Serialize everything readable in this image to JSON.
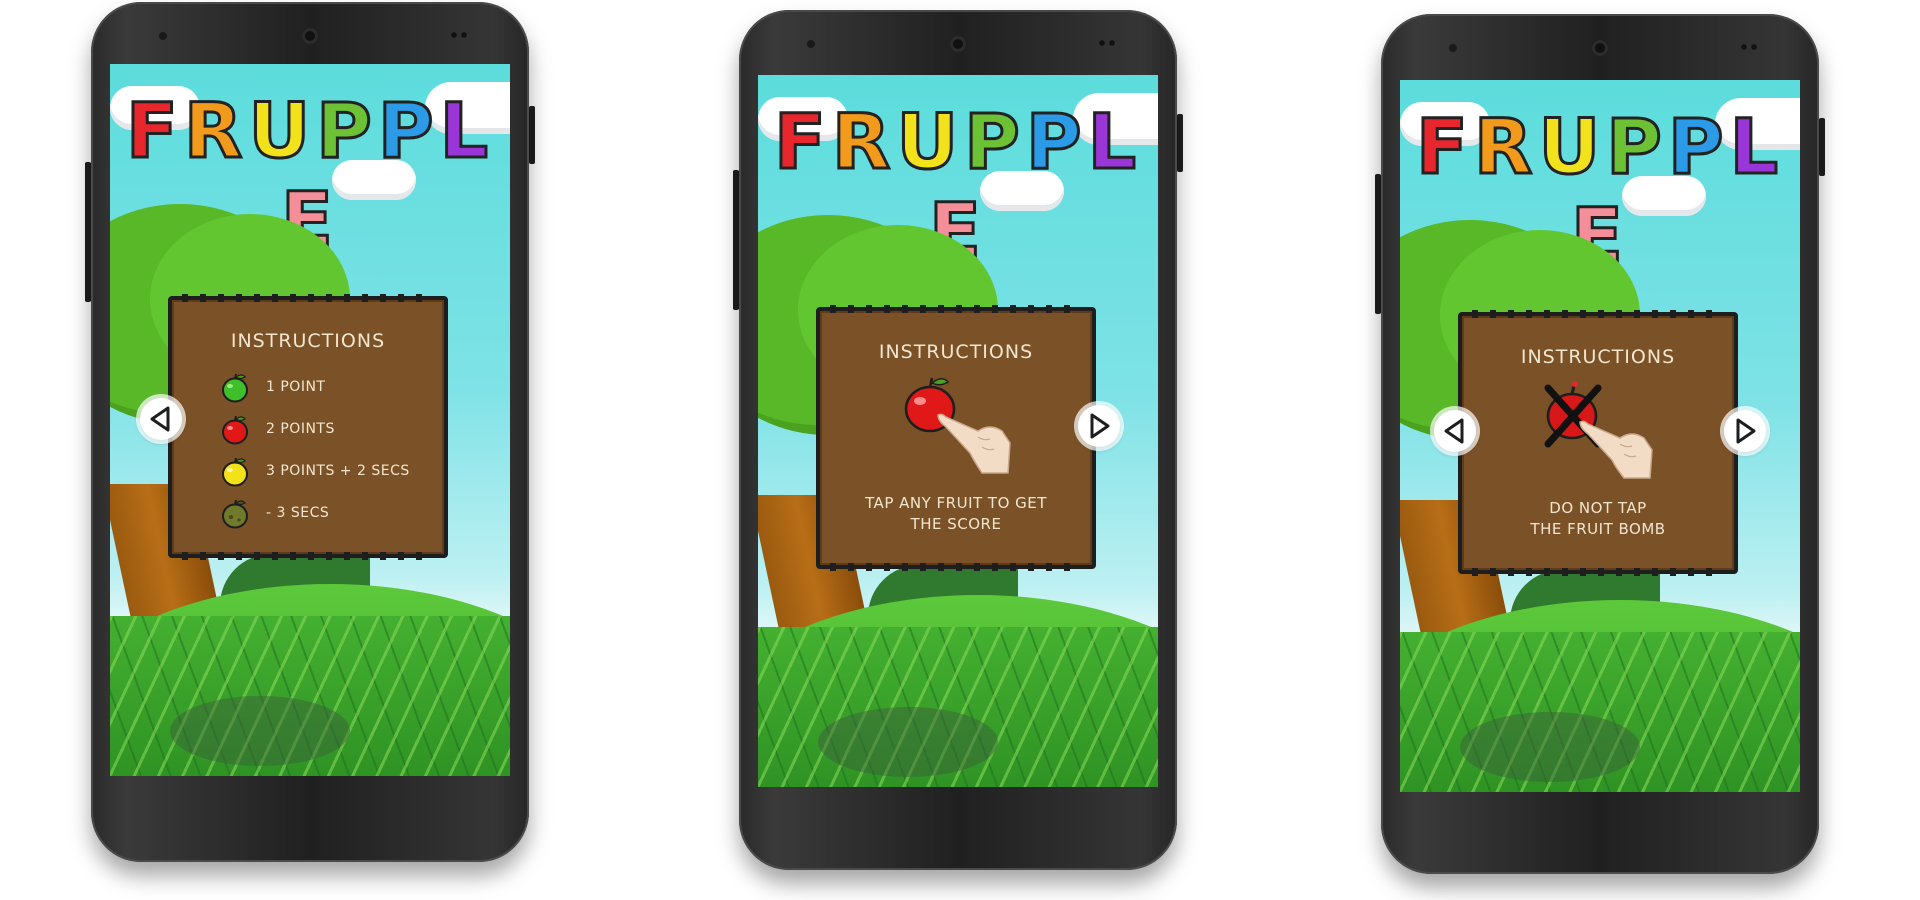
{
  "screens": [
    {
      "title_letters": [
        "F",
        "R",
        "U",
        "P",
        "P",
        "L",
        "E"
      ],
      "board_title": "INSTRUCTIONS",
      "legend": [
        {
          "icon": "green-apple-icon",
          "color": "#3fbf2a",
          "label": "1 POINT"
        },
        {
          "icon": "red-apple-icon",
          "color": "#e01818",
          "label": "2 POINTS"
        },
        {
          "icon": "yellow-apple-icon",
          "color": "#f3e21a",
          "label": "3 POINTS + 2 SECS"
        },
        {
          "icon": "rotten-apple-icon",
          "color": "#6f7a2a",
          "label": "- 3 SECS"
        }
      ],
      "prev_arrow": true,
      "next_arrow": false
    },
    {
      "title_letters": [
        "F",
        "R",
        "U",
        "P",
        "P",
        "L",
        "E"
      ],
      "board_title": "INSTRUCTIONS",
      "demo_icon": "tap-apple-icon",
      "caption_lines": [
        "TAP ANY FRUIT TO GET",
        "THE SCORE"
      ],
      "prev_arrow": false,
      "next_arrow": true
    },
    {
      "title_letters": [
        "F",
        "R",
        "U",
        "P",
        "P",
        "L",
        "E"
      ],
      "board_title": "INSTRUCTIONS",
      "demo_icon": "crossed-bomb-icon",
      "caption_lines": [
        "DO NOT TAP",
        "THE FRUIT BOMB"
      ],
      "prev_arrow": true,
      "next_arrow": true
    }
  ],
  "colors": {
    "title": [
      "#e8262d",
      "#f29a1c",
      "#f1e21b",
      "#6cc135",
      "#2b9be8",
      "#9a36d8",
      "#f48f9a"
    ],
    "board": "#7b5127",
    "sky": "#5cdcdc",
    "grass": "#3da52a"
  }
}
